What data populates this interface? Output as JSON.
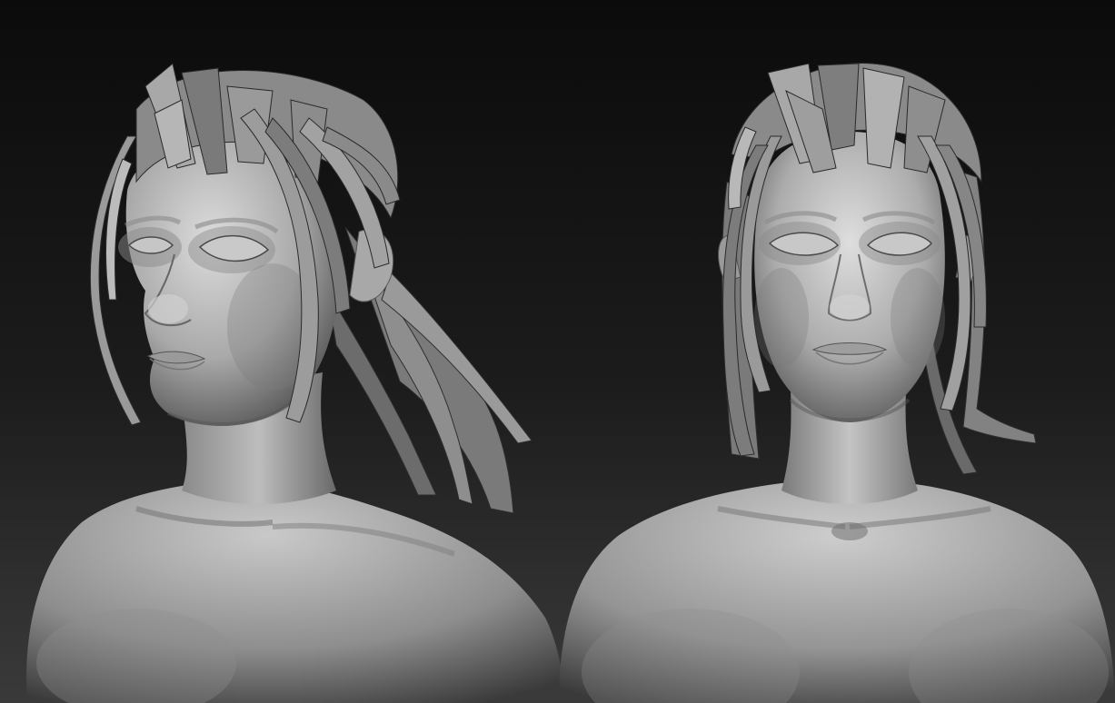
{
  "scene": {
    "background_top": "#0b0b0b",
    "background_bottom": "#3a3a3a",
    "clay_light": "#d2d2d2",
    "clay_mid": "#9a9a9a",
    "clay_dark": "#3c3c3c",
    "hair_light": "#bdbdbd",
    "hair_dark": "#4a4a4a"
  },
  "views": [
    {
      "view": "three-quarter-left"
    },
    {
      "view": "front"
    }
  ]
}
